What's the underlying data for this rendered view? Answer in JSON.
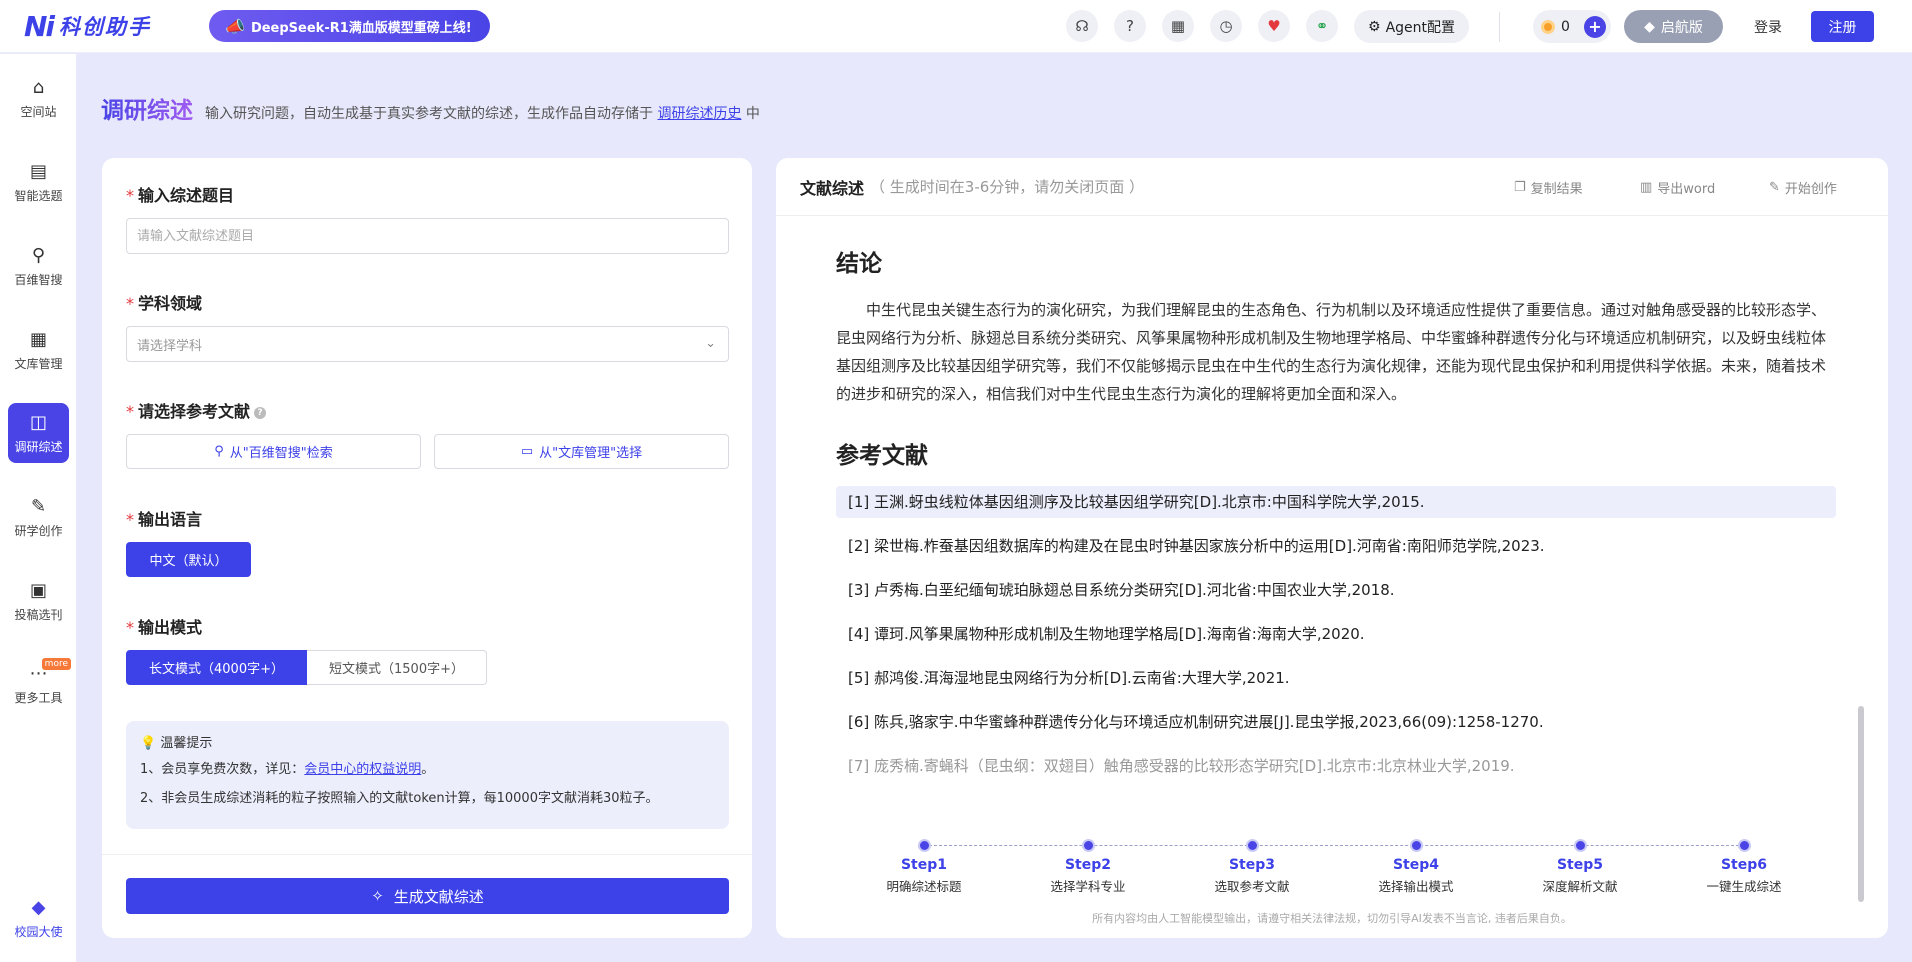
{
  "header": {
    "logo_mark": "Ni",
    "logo_text": "科创助手",
    "promo": "DeepSeek-R1满血版模型重磅上线!",
    "agent_label": "Agent配置",
    "coin_count": "0",
    "vip_label": "启航版",
    "login_label": "登录",
    "register_label": "注册"
  },
  "sidebar": {
    "items": [
      {
        "label": "空间站",
        "icon": "home-icon",
        "glyph": "⌂"
      },
      {
        "label": "智能选题",
        "icon": "clipboard-icon",
        "glyph": "▤"
      },
      {
        "label": "百维智搜",
        "icon": "search-bot-icon",
        "glyph": "⚲"
      },
      {
        "label": "文库管理",
        "icon": "library-icon",
        "glyph": "▦"
      },
      {
        "label": "调研综述",
        "icon": "book-open-icon",
        "glyph": "◫"
      },
      {
        "label": "研学创作",
        "icon": "edit-icon",
        "glyph": "✎"
      },
      {
        "label": "投稿选刊",
        "icon": "journal-icon",
        "glyph": "▣"
      },
      {
        "label": "更多工具",
        "icon": "more-icon",
        "glyph": "⋯"
      },
      {
        "label": "校园大使",
        "icon": "graduation-cap-icon",
        "glyph": "◆"
      }
    ],
    "more_badge": "more"
  },
  "page": {
    "title": "调研综述",
    "desc_before": "输入研究问题，自动生成基于真实参考文献的综述，生成作品自动存储于",
    "desc_link": "调研综述历史",
    "desc_after": "中"
  },
  "form": {
    "topic_label": "输入综述题目",
    "topic_placeholder": "请输入文献综述题目",
    "subject_label": "学科领域",
    "subject_placeholder": "请选择学科",
    "refs_label": "请选择参考文献",
    "ref_btn_search": "从\"百维智搜\"检索",
    "ref_btn_library": "从\"文库管理\"选择",
    "lang_label": "输出语言",
    "lang_value": "中文（默认）",
    "mode_label": "输出模式",
    "mode_long": "长文模式（4000字+）",
    "mode_short": "短文模式（1500字+）",
    "tips_title": "温馨提示",
    "tip1_before": "1、会员享免费次数，详见：",
    "tip1_link": "会员中心的权益说明",
    "tip1_after": "。",
    "tip2": "2、非会员生成综述消耗的粒子按照输入的文献token计算，每10000字文献消耗30粒子。",
    "generate_label": "生成文献综述"
  },
  "result": {
    "title": "文献综述",
    "subtitle": "（ 生成时间在3-6分钟，请勿关闭页面 ）",
    "copy_label": "复制结果",
    "export_label": "导出word",
    "create_label": "开始创作",
    "conclusion_title": "结论",
    "conclusion_text": "中生代昆虫关键生态行为的演化研究，为我们理解昆虫的生态角色、行为机制以及环境适应性提供了重要信息。通过对触角感受器的比较形态学、昆虫网络行为分析、脉翅总目系统分类研究、风筝果属物种形成机制及生物地理学格局、中华蜜蜂种群遗传分化与环境适应机制研究，以及蚜虫线粒体基因组测序及比较基因组学研究等，我们不仅能够揭示昆虫在中生代的生态行为演化规律，还能为现代昆虫保护和利用提供科学依据。未来，随着技术的进步和研究的深入，相信我们对中生代昆虫生态行为演化的理解将更加全面和深入。",
    "refs_title": "参考文献",
    "references": [
      "[1] 王渊.蚜虫线粒体基因组测序及比较基因组学研究[D].北京市:中国科学院大学,2015.",
      "[2] 梁世梅.柞蚕基因组数据库的构建及在昆虫时钟基因家族分析中的运用[D].河南省:南阳师范学院,2023.",
      "[3] 卢秀梅.白垩纪缅甸琥珀脉翅总目系统分类研究[D].河北省:中国农业大学,2018.",
      "[4] 谭珂.风筝果属物种形成机制及生物地理学格局[D].海南省:海南大学,2020.",
      "[5] 郝鸿俊.洱海湿地昆虫网络行为分析[D].云南省:大理大学,2021.",
      "[6] 陈兵,骆家宇.中华蜜蜂种群遗传分化与环境适应机制研究进展[J].昆虫学报,2023,66(09):1258-1270.",
      "[7] 庞秀楠.寄蝇科（昆虫纲：双翅目）触角感受器的比较形态学研究[D].北京市:北京林业大学,2019."
    ],
    "steps": [
      {
        "name": "Step1",
        "desc": "明确综述标题"
      },
      {
        "name": "Step2",
        "desc": "选择学科专业"
      },
      {
        "name": "Step3",
        "desc": "选取参考文献"
      },
      {
        "name": "Step4",
        "desc": "选择输出模式"
      },
      {
        "name": "Step5",
        "desc": "深度解析文献"
      },
      {
        "name": "Step6",
        "desc": "一键生成综述"
      }
    ],
    "disclaimer": "所有内容均由人工智能模型输出，请遵守相关法律法规，切勿引导AI发表不当言论, 违者后果自负。"
  },
  "colors": {
    "brand": "#3d41e8",
    "accent_purple": "#7b5cf0",
    "page_bg": "#e7e8fb",
    "required": "#e4393c"
  }
}
